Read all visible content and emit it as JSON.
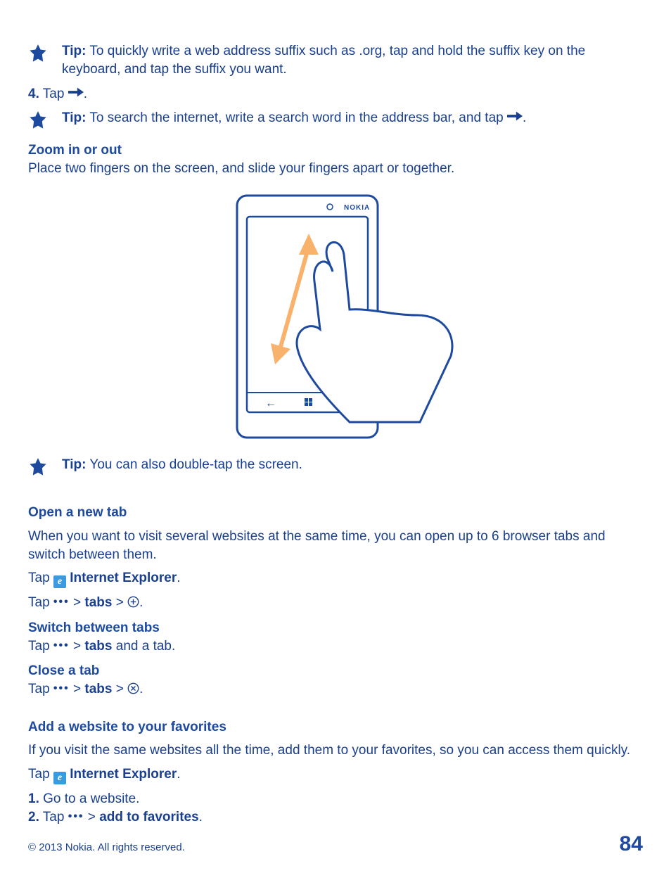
{
  "tip1": {
    "label": "Tip:",
    "text": " To quickly write a web address suffix such as .org, tap and hold the suffix key on the keyboard, and tap the suffix you want."
  },
  "step4": {
    "num": "4.",
    "text": " Tap ",
    "period": "."
  },
  "tip2": {
    "label": "Tip:",
    "text": " To search the internet, write a search word in the address bar, and tap ",
    "period": "."
  },
  "zoom": {
    "heading": "Zoom in or out",
    "text": "Place two fingers on the screen, and slide your fingers apart or together."
  },
  "tip3": {
    "label": "Tip:",
    "text": " You can also double-tap the screen."
  },
  "open_tab": {
    "heading": "Open a new tab",
    "body": "When you want to visit several websites at the same time, you can open up to 6 browser tabs and switch between them.",
    "tap_prefix": "Tap ",
    "ie_label": " Internet Explorer",
    "period": ".",
    "line2_tap": "Tap  ",
    "gt1": "  > ",
    "tabs": "tabs",
    "gt2": " > "
  },
  "switch_tabs": {
    "heading": "Switch between tabs",
    "tap": "Tap  ",
    "gt": "  > ",
    "tabs": "tabs",
    "suffix": " and a tab."
  },
  "close_tab": {
    "heading": "Close a tab",
    "tap": "Tap  ",
    "gt1": "  > ",
    "tabs": "tabs",
    "gt2": " > ",
    "period": "."
  },
  "favorites": {
    "heading": "Add a website to your favorites",
    "body": "If you visit the same websites all the time, add them to your favorites, so you can access them quickly.",
    "tap_prefix": "Tap ",
    "ie_label": " Internet Explorer",
    "period": ".",
    "s1_num": "1.",
    "s1_text": " Go to a website.",
    "s2_num": "2.",
    "s2_tap": " Tap  ",
    "s2_gt": "  > ",
    "s2_action": "add to favorites",
    "s2_period": "."
  },
  "footer": {
    "copyright": "© 2013 Nokia. All rights reserved.",
    "page": "84"
  }
}
